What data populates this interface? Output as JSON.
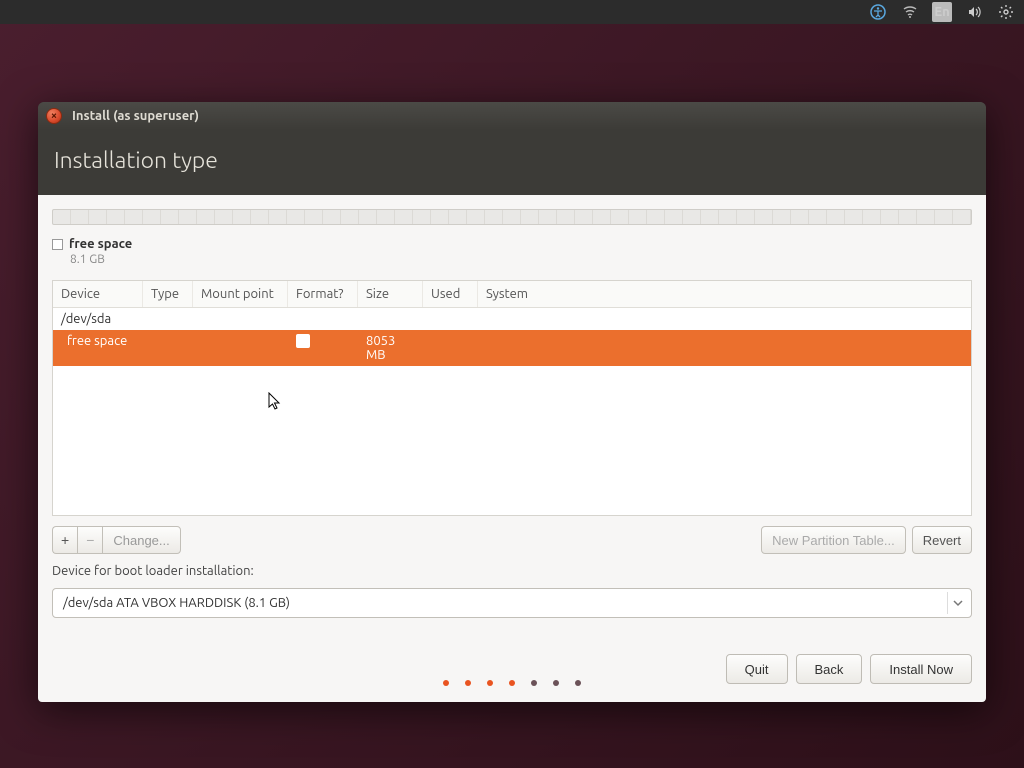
{
  "topbar": {
    "lang": "En"
  },
  "window": {
    "title": "Install (as superuser)"
  },
  "heading": "Installation type",
  "free_space": {
    "label": "free space",
    "size": "8.1 GB"
  },
  "table": {
    "headers": {
      "device": "Device",
      "type": "Type",
      "mount": "Mount point",
      "format": "Format?",
      "size": "Size",
      "used": "Used",
      "system": "System"
    },
    "device_row": "/dev/sda",
    "selected_row": {
      "device": "free space",
      "size": "8053 MB"
    }
  },
  "toolbar": {
    "plus": "+",
    "minus": "−",
    "change": "Change...",
    "new_partition": "New Partition Table...",
    "revert": "Revert"
  },
  "bootloader": {
    "label": "Device for boot loader installation:",
    "selected": "/dev/sda  ATA VBOX HARDDISK (8.1 GB)"
  },
  "footer": {
    "quit": "Quit",
    "back": "Back",
    "install": "Install Now"
  },
  "progress": {
    "total": 7,
    "active": 4
  }
}
